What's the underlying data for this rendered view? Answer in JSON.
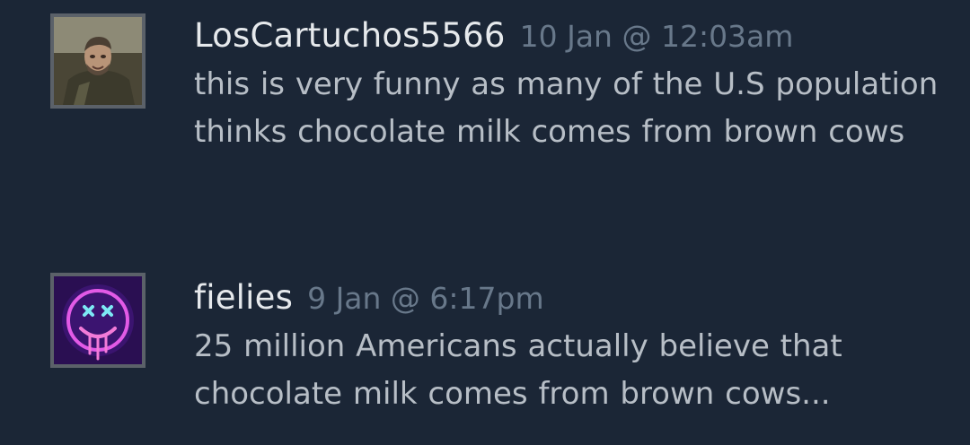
{
  "comments": [
    {
      "author": "LosCartuchos5566",
      "timestamp": "10 Jan @ 12:03am",
      "text": "this is very funny as many of the U.S population thinks chocolate milk comes from brown cows",
      "avatar_icon": "user-photo-avatar-icon"
    },
    {
      "author": "fielies",
      "timestamp": "9 Jan @ 6:17pm",
      "text": "25 million Americans actually believe that chocolate milk comes from brown cows...",
      "avatar_icon": "neon-smiley-avatar-icon"
    }
  ],
  "colors": {
    "background": "#1b2636",
    "author": "#e6e9ec",
    "timestamp": "#68788a",
    "text": "#b7bec6",
    "avatar_border": "#5b6169"
  }
}
